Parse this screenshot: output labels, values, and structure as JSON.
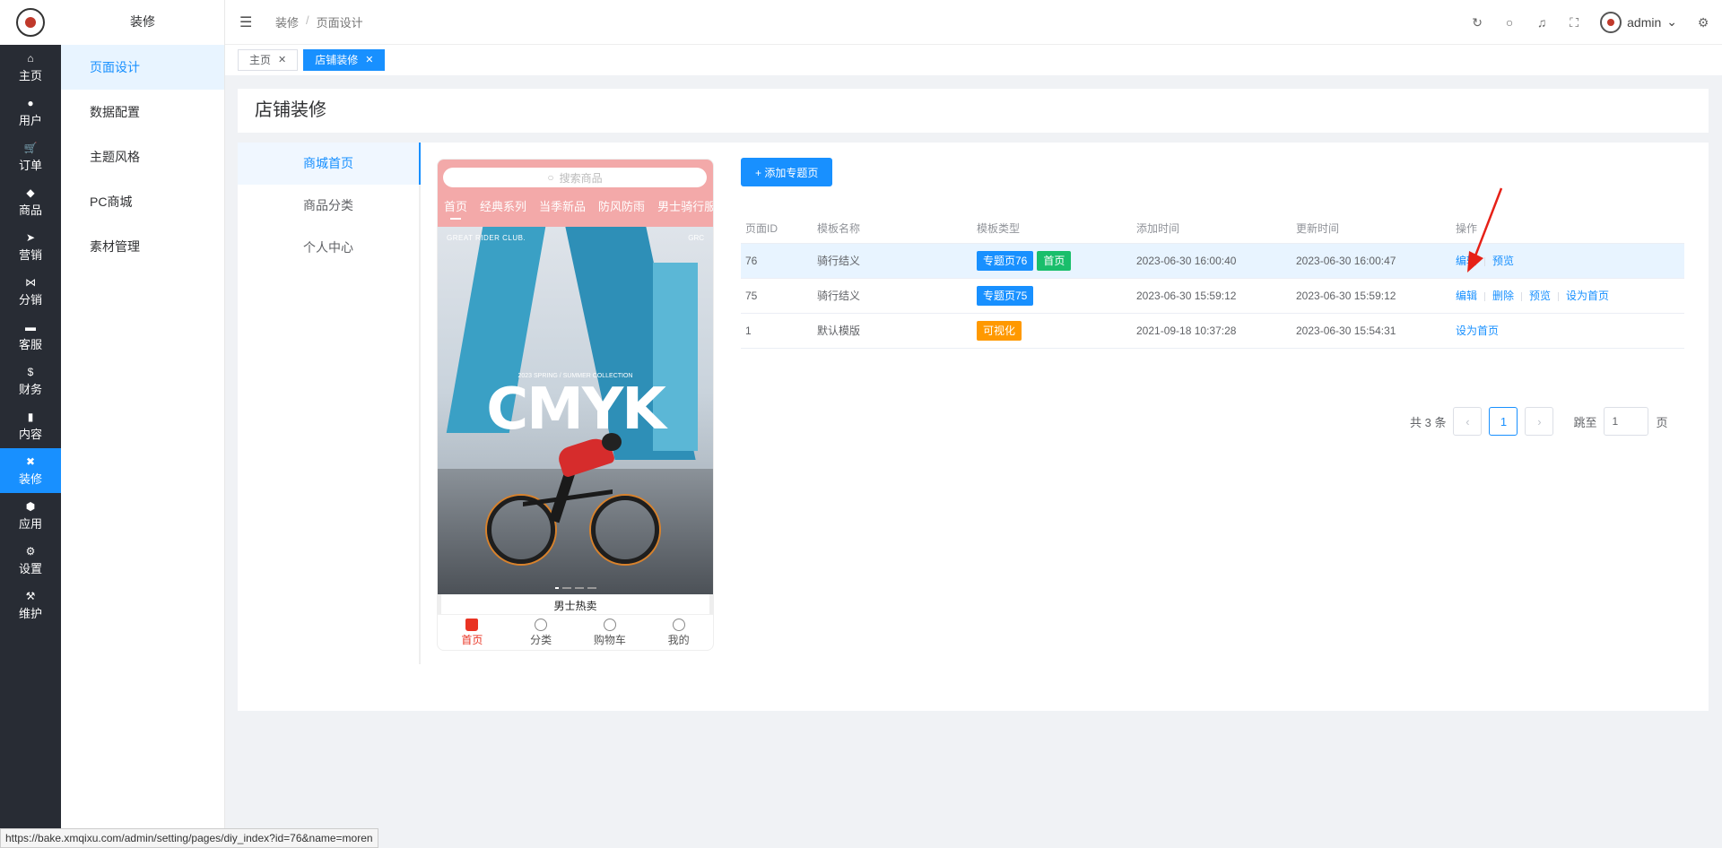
{
  "sidebar": {
    "items": [
      {
        "icon": "home-icon",
        "glyph": "⌂",
        "label": "主页"
      },
      {
        "icon": "user-icon",
        "glyph": "●",
        "label": "用户"
      },
      {
        "icon": "cart-icon",
        "glyph": "🛒",
        "label": "订单"
      },
      {
        "icon": "basket-icon",
        "glyph": "◆",
        "label": "商品"
      },
      {
        "icon": "send-icon",
        "glyph": "➤",
        "label": "营销"
      },
      {
        "icon": "share-icon",
        "glyph": "⋈",
        "label": "分销"
      },
      {
        "icon": "chat-icon",
        "glyph": "▬",
        "label": "客服"
      },
      {
        "icon": "dollar-icon",
        "glyph": "$",
        "label": "财务"
      },
      {
        "icon": "book-icon",
        "glyph": "▮",
        "label": "内容"
      },
      {
        "icon": "tools-icon",
        "glyph": "✖",
        "label": "装修"
      },
      {
        "icon": "cube-icon",
        "glyph": "⬢",
        "label": "应用"
      },
      {
        "icon": "gear-icon",
        "glyph": "⚙",
        "label": "设置"
      },
      {
        "icon": "hammer-icon",
        "glyph": "⚒",
        "label": "维护"
      }
    ],
    "active_index": 9
  },
  "submenu": {
    "title": "装修",
    "items": [
      "页面设计",
      "数据配置",
      "主题风格",
      "PC商城",
      "素材管理"
    ]
  },
  "header": {
    "breadcrumb": [
      "装修",
      "页面设计"
    ],
    "user_name": "admin"
  },
  "tabs": [
    {
      "label": "主页"
    },
    {
      "label": "店铺装修"
    }
  ],
  "page_title": "店铺装修",
  "left_tabs": [
    "商城首页",
    "商品分类",
    "个人中心"
  ],
  "phone": {
    "search_placeholder": "搜索商品",
    "categories": [
      "首页",
      "经典系列",
      "当季新品",
      "防风防雨",
      "男士骑行服"
    ],
    "banner_brand": "GREAT RIDER CLUB.",
    "banner_brand_right": "GRC",
    "banner_sub": "2023 SPRING / SUMMER COLLECTION",
    "banner_title": "CMYK",
    "section_title": "男士热卖",
    "bottom_nav": [
      "首页",
      "分类",
      "购物车",
      "我的"
    ]
  },
  "add_button": "+ 添加专题页",
  "table": {
    "headers": [
      "页面ID",
      "模板名称",
      "模板类型",
      "添加时间",
      "更新时间",
      "操作"
    ],
    "rows": [
      {
        "id": "76",
        "name": "骑行结义",
        "tags": [
          "专题页76",
          "首页"
        ],
        "added": "2023-06-30 16:00:40",
        "updated": "2023-06-30 16:00:47",
        "ops": [
          "编辑",
          "预览"
        ]
      },
      {
        "id": "75",
        "name": "骑行结义",
        "tags": [
          "专题页75"
        ],
        "added": "2023-06-30 15:59:12",
        "updated": "2023-06-30 15:59:12",
        "ops": [
          "编辑",
          "删除",
          "预览",
          "设为首页"
        ]
      },
      {
        "id": "1",
        "name": "默认模版",
        "tags": [
          "可视化"
        ],
        "added": "2021-09-18 10:37:28",
        "updated": "2023-06-30 15:54:31",
        "ops": [
          "设为首页"
        ]
      }
    ]
  },
  "pager": {
    "total": "共 3 条",
    "current": "1",
    "jump_label": "跳至",
    "jump_value": "1",
    "page_suffix": "页"
  },
  "status_url": "https://bake.xmqixu.com/admin/setting/pages/diy_index?id=76&name=moren",
  "colors": {
    "primary": "#1890ff",
    "sidebar": "#282c34",
    "tag_green": "#19be6b",
    "tag_orange": "#ff9900",
    "phone_header": "#f3a9a9"
  }
}
